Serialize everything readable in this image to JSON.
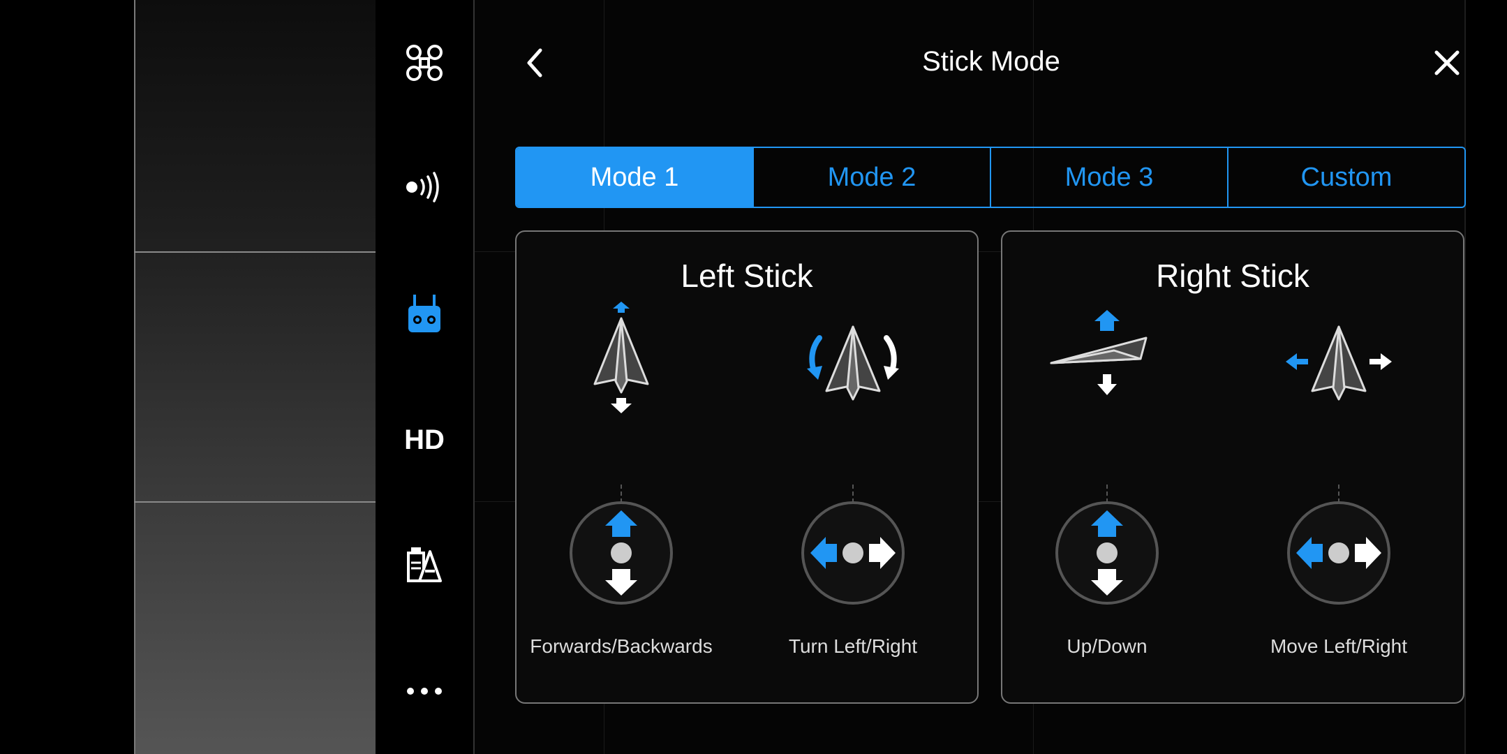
{
  "header": {
    "title": "Stick Mode"
  },
  "rail": {
    "items": [
      {
        "name": "aircraft",
        "icon": "drone-icon"
      },
      {
        "name": "sensors",
        "icon": "signal-icon"
      },
      {
        "name": "remote-controller",
        "icon": "remote-controller-icon",
        "active": true
      },
      {
        "name": "video",
        "icon": "hd-icon",
        "label": "HD"
      },
      {
        "name": "battery",
        "icon": "battery-icon"
      },
      {
        "name": "more",
        "icon": "more-icon"
      }
    ]
  },
  "tabs": [
    {
      "label": "Mode 1",
      "active": true
    },
    {
      "label": "Mode 2",
      "active": false
    },
    {
      "label": "Mode 3",
      "active": false
    },
    {
      "label": "Custom",
      "active": false
    }
  ],
  "left_stick": {
    "title": "Left Stick",
    "controls": [
      {
        "label": "Forwards/Backwards"
      },
      {
        "label": "Turn Left/Right"
      }
    ]
  },
  "right_stick": {
    "title": "Right Stick",
    "controls": [
      {
        "label": "Up/Down"
      },
      {
        "label": "Move Left/Right"
      }
    ]
  },
  "colors": {
    "accent": "#2196f3",
    "background": "#000000",
    "text": "#ffffff",
    "card_border": "#777777"
  }
}
